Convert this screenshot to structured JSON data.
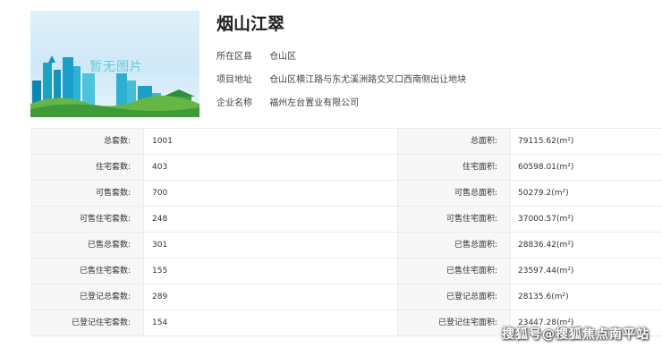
{
  "project": {
    "title": "烟山江翠",
    "image_placeholder_text": "暂无图片",
    "info": [
      {
        "key": "所在区县",
        "value": "仓山区"
      },
      {
        "key": "项目地址",
        "value": "仓山区横江路与东尤溪洲路交叉口西南侧出让地块"
      },
      {
        "key": "企业名称",
        "value": "福州左台置业有限公司"
      }
    ]
  },
  "stats": [
    {
      "label_left": "总套数:",
      "value_left": "1001",
      "label_right": "总面积:",
      "value_right": "79115.62(m²)"
    },
    {
      "label_left": "住宅套数:",
      "value_left": "403",
      "label_right": "住宅面积:",
      "value_right": "60598.01(m²)"
    },
    {
      "label_left": "可售套数:",
      "value_left": "700",
      "label_right": "可售总面积:",
      "value_right": "50279.2(m²)"
    },
    {
      "label_left": "可售住宅套数:",
      "value_left": "248",
      "label_right": "可售住宅面积:",
      "value_right": "37000.57(m²)"
    },
    {
      "label_left": "已售总套数:",
      "value_left": "301",
      "label_right": "已售总面积:",
      "value_right": "28836.42(m²)"
    },
    {
      "label_left": "已售住宅套数:",
      "value_left": "155",
      "label_right": "已售住宅面积:",
      "value_right": "23597.44(m²)"
    },
    {
      "label_left": "已登记总套数:",
      "value_left": "289",
      "label_right": "已登记总面积:",
      "value_right": "28135.6(m²)"
    },
    {
      "label_left": "已登记住宅套数:",
      "value_left": "154",
      "label_right": "已登记住宅面积:",
      "value_right": "23447.28(m²)"
    }
  ],
  "watermark": "搜狐号@搜狐焦点南平站"
}
